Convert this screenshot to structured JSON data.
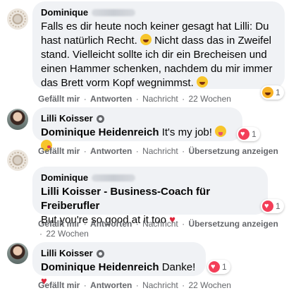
{
  "comments": [
    {
      "author": "Dominique",
      "text": "Falls es dir heute noch keiner gesagt hat Lilli: Du hast natürlich Recht.",
      "text2": "Nicht dass das in Zweifel stand. Vielleicht sollte ich dir ein Brecheisen und einen Hammer schenken, nachdem du mir immer das Brett vorm Kopf wegnimmst.",
      "emoji1": "laugh-emoji",
      "emoji2": "laugh-emoji",
      "reaction_icon": "haha-icon",
      "reaction_count": "1",
      "actions": [
        "Gefällt mir",
        "Antworten",
        "Nachricht",
        "22 Wochen"
      ]
    },
    {
      "author": "Lilli Koisser",
      "mention": "Dominique Heidenreich",
      "text": "It's my job!",
      "emojis": [
        "tongue-emoji",
        "kiss-emoji"
      ],
      "reaction_icon": "heart-icon",
      "reaction_count": "1",
      "actions": [
        "Gefällt mir",
        "Antworten",
        "Nachricht",
        "Übersetzung anzeigen"
      ]
    },
    {
      "author": "Dominique",
      "mention": "Lilli Koisser - Business-Coach für Freiberufler",
      "text": "But you're so good at it too",
      "emoji": "red-heart",
      "reaction_icon": "heart-icon",
      "reaction_count": "1",
      "actions": [
        "Gefällt mir",
        "Antworten",
        "Nachricht",
        "Übersetzung anzeigen"
      ],
      "time": "22 Wochen"
    },
    {
      "author": "Lilli Koisser",
      "mention": "Dominique Heidenreich",
      "text": "Danke!",
      "emoji": "red-heart",
      "reaction_icon": "heart-icon",
      "reaction_count": "1",
      "actions": [
        "Gefällt mir",
        "Antworten",
        "Nachricht",
        "22 Wochen"
      ]
    }
  ],
  "separator": "·",
  "heart_glyph": "♥",
  "colors": {
    "bubble": "#f0f2f5",
    "meta": "#65676b",
    "heart": "#f33e58",
    "haha": "#f7b125"
  }
}
